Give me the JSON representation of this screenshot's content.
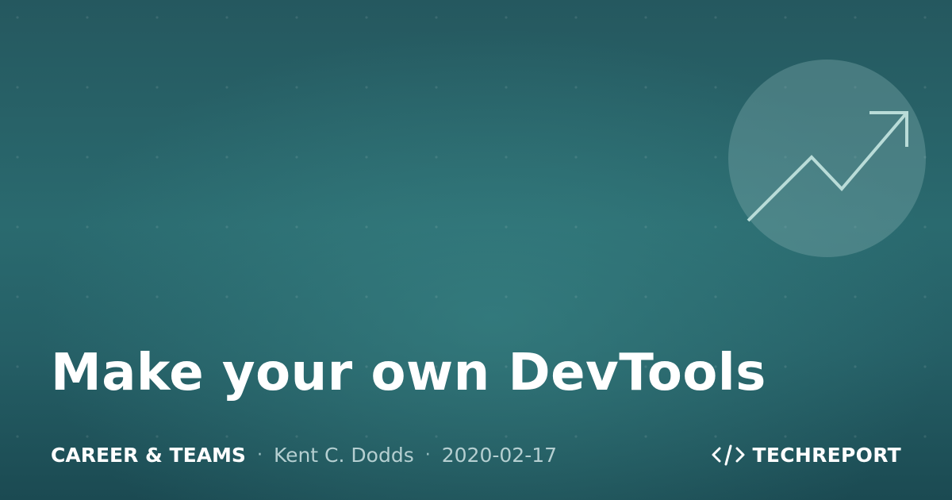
{
  "card": {
    "title": "Make your own DevTools",
    "category": "CAREER & TEAMS",
    "separator": "·",
    "author": "Kent C. Dodds",
    "date": "2020-02-17"
  },
  "brand": {
    "name": "TECHREPORT",
    "icon": "code-brackets-icon"
  },
  "decoration": {
    "icon": "trending-up-arrow-icon"
  },
  "colors": {
    "background_dark": "#1b4a52",
    "background_mid": "#2a6a6f",
    "circle": "#78a5a8",
    "accent_line": "#b9dcd8",
    "text_primary": "#ffffff",
    "text_muted": "#b5cfd1"
  }
}
